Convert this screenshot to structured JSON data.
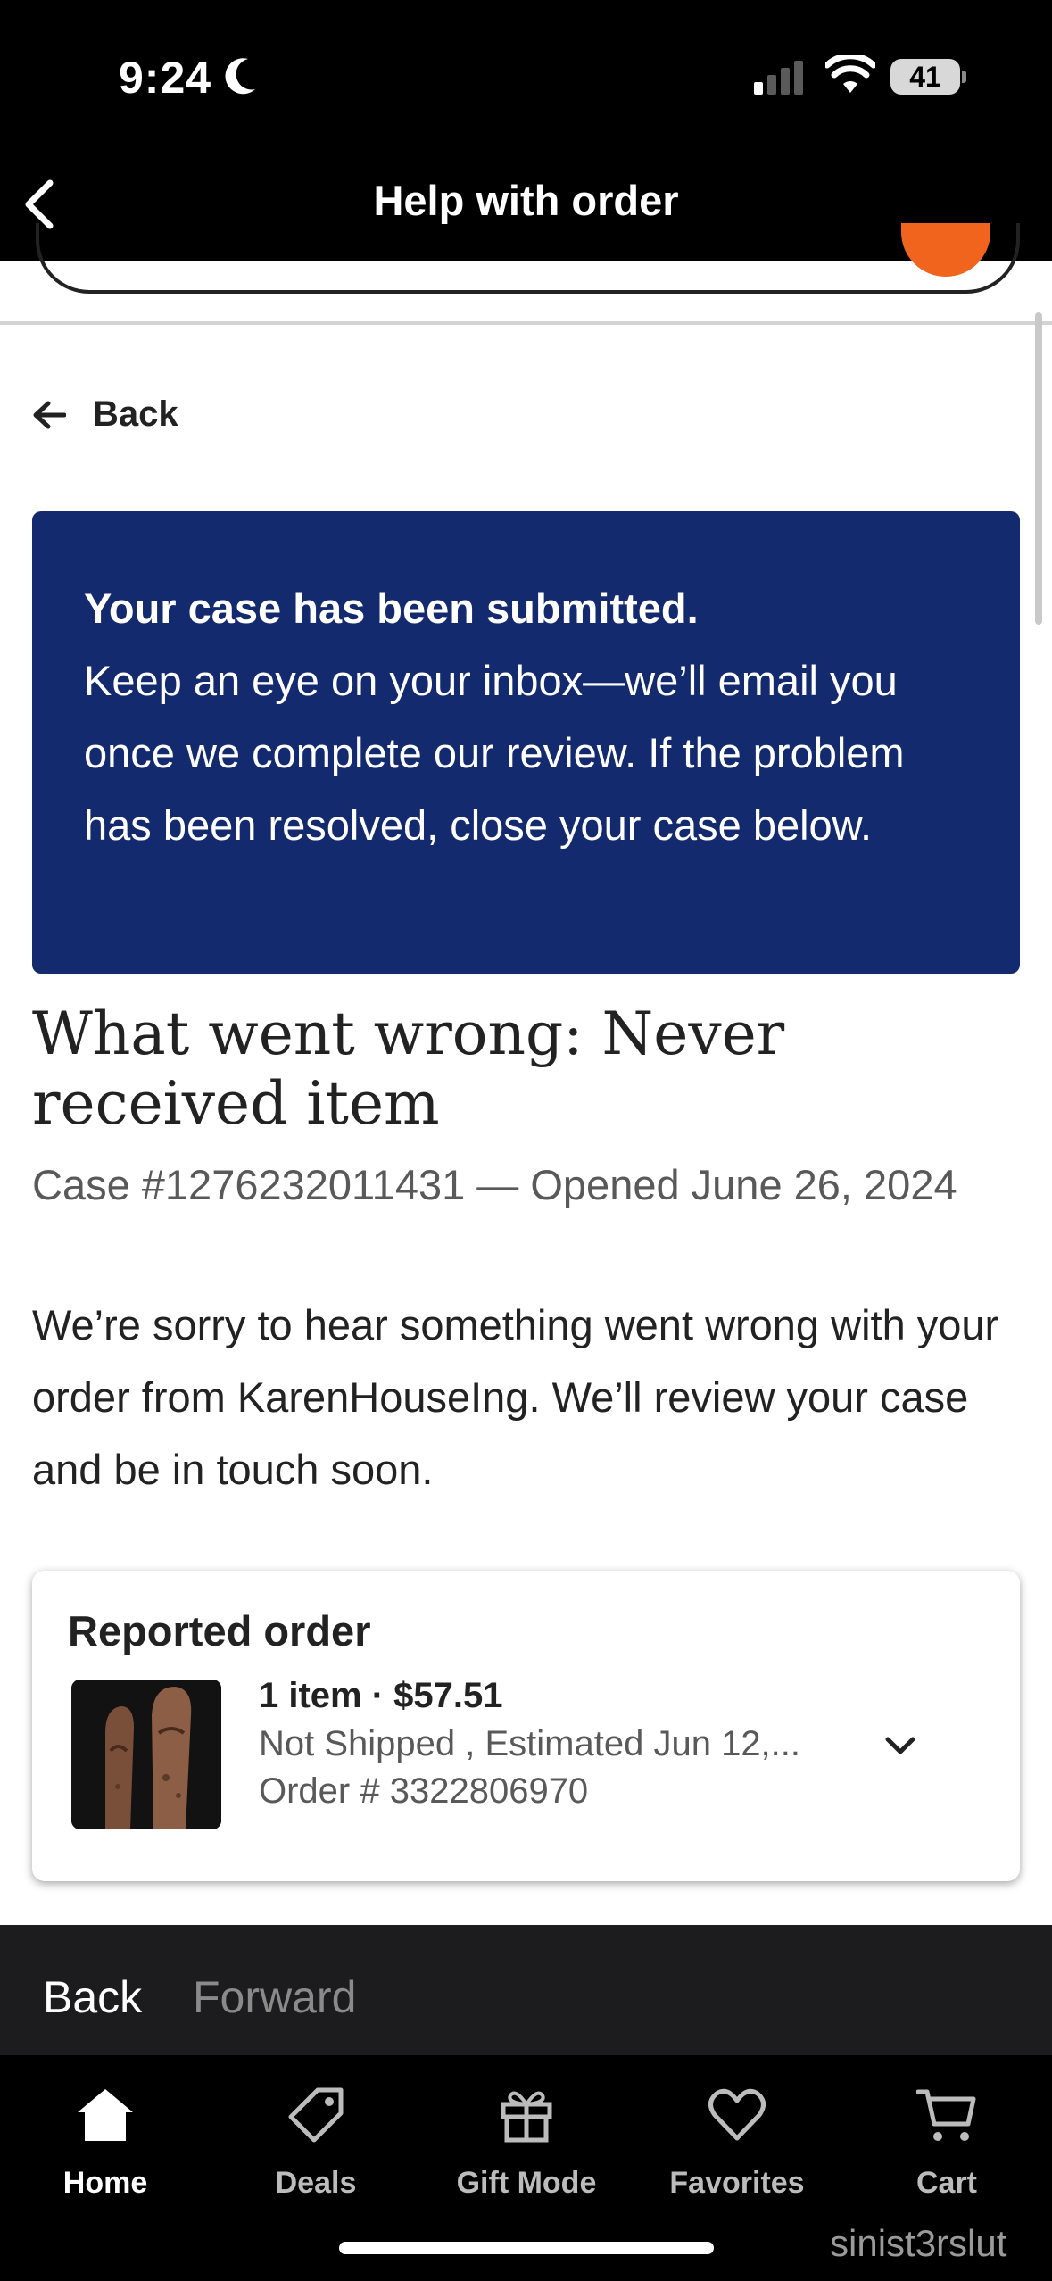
{
  "status_bar": {
    "time": "9:24",
    "battery": "41"
  },
  "nav": {
    "title": "Help with order"
  },
  "back_link": {
    "label": "Back"
  },
  "banner": {
    "title": "Your case has been submitted.",
    "message": "Keep an eye on your inbox—we’ll email you once we complete our review. If the problem has been resolved, close your case below."
  },
  "case": {
    "heading": "What went wrong: Never received item",
    "subline": "Case #1276232011431 — Opened June 26, 2024",
    "body": "We’re sorry to hear something went wrong with your order from KarenHouseIng. We’ll review your case and be in touch soon."
  },
  "order_card": {
    "title": "Reported order",
    "summary": "1 item · $57.51",
    "status": "Not Shipped , Estimated Jun 12,...",
    "order_number": "Order # 3322806970"
  },
  "browser_bar": {
    "back": "Back",
    "forward": "Forward"
  },
  "tabs": [
    {
      "label": "Home",
      "icon": "home-icon",
      "active": true
    },
    {
      "label": "Deals",
      "icon": "tag-icon",
      "active": false
    },
    {
      "label": "Gift Mode",
      "icon": "gift-icon",
      "active": false
    },
    {
      "label": "Favorites",
      "icon": "heart-icon",
      "active": false
    },
    {
      "label": "Cart",
      "icon": "cart-icon",
      "active": false
    }
  ],
  "watermark": "sinist3rslut",
  "colors": {
    "banner": "#142a6e",
    "accent": "#f1641e"
  }
}
